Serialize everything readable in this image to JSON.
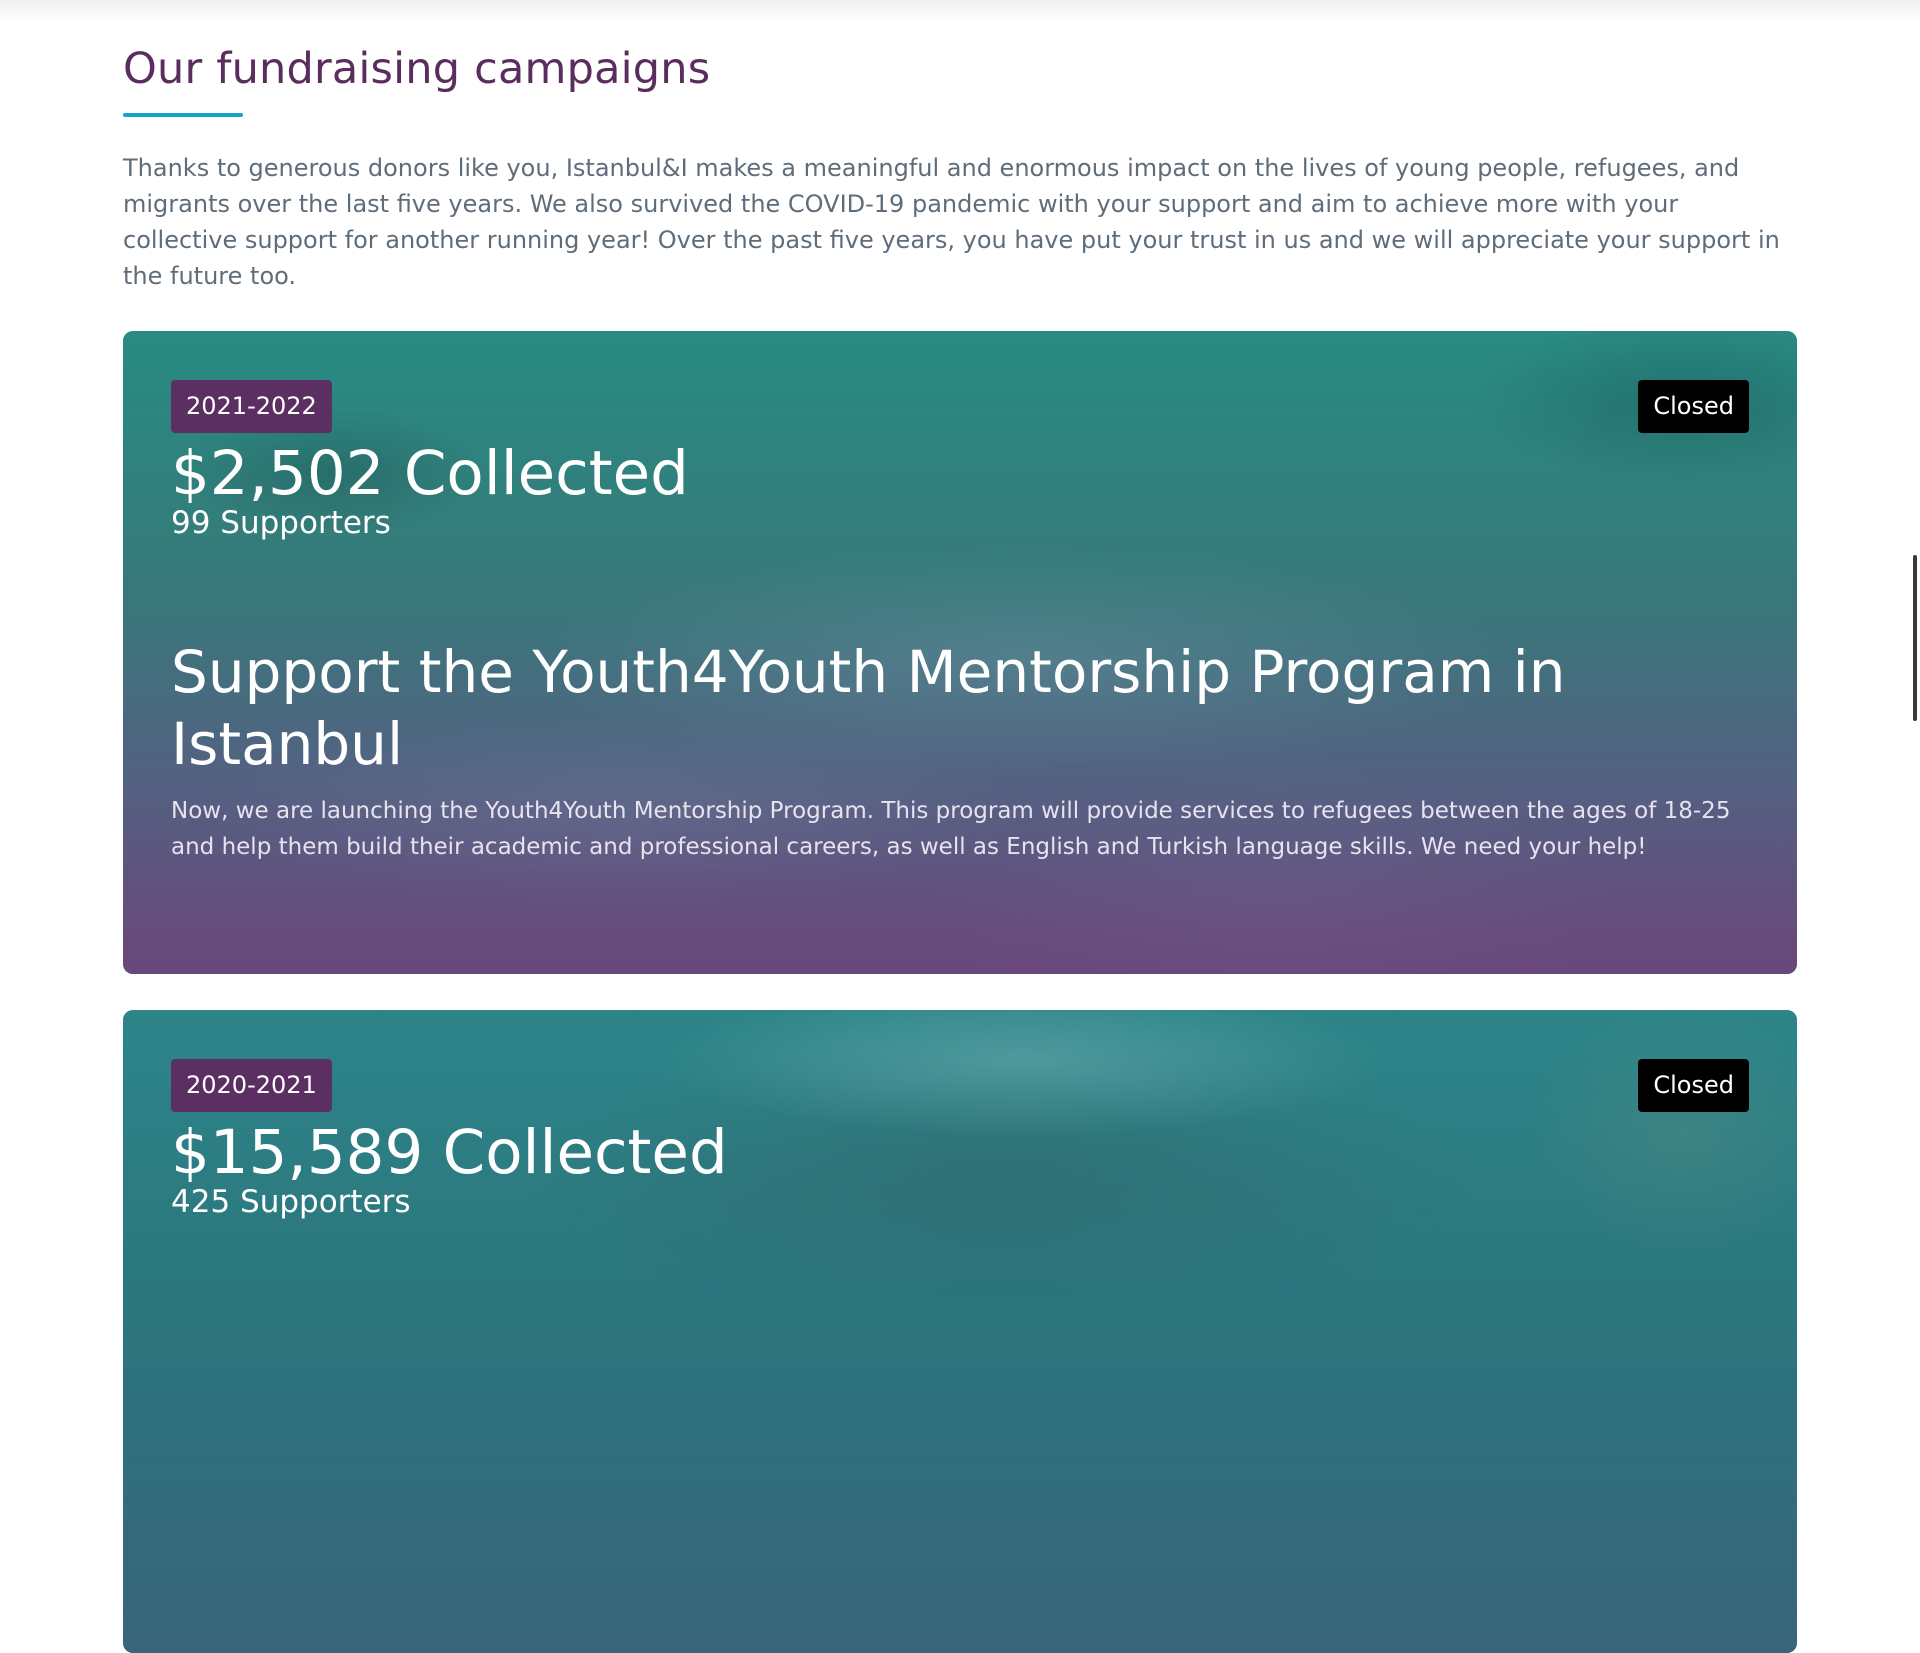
{
  "section": {
    "title": "Our fundraising campaigns",
    "intro": "Thanks to generous donors like you, Istanbul&I makes a meaningful and enormous impact on the lives of young people, refugees, and migrants over the last five years. We also survived the COVID-19 pandemic with your support and aim to achieve more with your collective support for another running year! Over the past five years, you have put your trust in us and we will appreciate your support in the future too."
  },
  "campaigns": [
    {
      "year": "2021-2022",
      "status": "Closed",
      "collected": "$2,502 Collected",
      "supporters": "99 Supporters",
      "title": "Support the Youth4Youth Mentorship Program in Istanbul",
      "description": "Now, we are launching the Youth4Youth Mentorship Program. This program will provide services to refugees between the ages of 18-25 and help them build their academic and professional careers, as well as English and Turkish language skills. We need your help!"
    },
    {
      "year": "2020-2021",
      "status": "Closed",
      "collected": "$15,589 Collected",
      "supporters": "425 Supporters"
    }
  ],
  "colors": {
    "title": "#5a2d5e",
    "accent_underline": "#1aa3c8",
    "year_badge": "#5c2f62",
    "status_badge": "#000000",
    "body_text": "#5f6d7a"
  }
}
